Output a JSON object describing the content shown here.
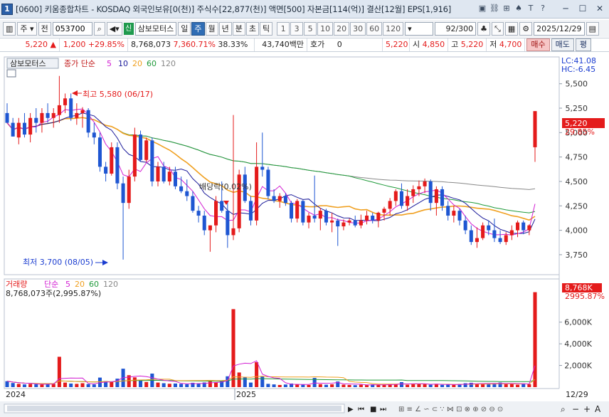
{
  "window": {
    "number": "1",
    "title": "[0600] 키움종합차트 - KOSDAQ 외국인보유[0(천)] 주식수[22,877(천)] 액면[500] 자본금[114(억)] 결산[12월] EPS[1,916]"
  },
  "toolbar": {
    "market_select": "주",
    "all_button": "전",
    "stock_code": "053700",
    "credit_badge": "신",
    "stock_name": "삼보모터스",
    "period_buttons": [
      "일",
      "주",
      "월",
      "년",
      "분",
      "초",
      "틱"
    ],
    "active_period": "주",
    "minute_buttons": [
      "1",
      "3",
      "5",
      "10",
      "20",
      "30",
      "60",
      "120"
    ],
    "count": "92/300",
    "date": "2025/12/29"
  },
  "quote": {
    "price": "5,220",
    "change": "1,200",
    "change_pct": "+29.85%",
    "volume": "8,768,073",
    "volume_pct": "7,360.71%",
    "turnover_pct": "38.33%",
    "amount": "43,740백만",
    "hoga_label": "호가",
    "hoga_value": "0",
    "hoga_price": "5,220",
    "open_label": "시",
    "open_value": "4,850",
    "high_label": "고",
    "high_value": "5,220",
    "low_label": "저",
    "low_value": "4,700",
    "buy_button": "매수",
    "sell_button": "매도",
    "eval_button": "평"
  },
  "price_panel": {
    "stock_tab": "삼보모터스",
    "legend_label": "종가 단순",
    "legend_periods": [
      "5",
      "10",
      "20",
      "60",
      "120"
    ],
    "lc": "LC:41.08",
    "hc": "HC:-6.45",
    "high_annotation": "최고 5,580 (06/17)",
    "low_annotation": "최저 3,700 (08/05)",
    "dividend_annotation": "배당락(0.02%)",
    "current_price_label": "5,220",
    "current_change_label": "29.85%"
  },
  "volume_panel": {
    "legend_label": "거래량",
    "legend_ma": "단순",
    "legend_periods": [
      "5",
      "20",
      "60",
      "120"
    ],
    "volume_text": "8,768,073주(2,995.87%)",
    "current_volume_label": "8,768K",
    "current_volume_pct": "2995.87%"
  },
  "x_axis": {
    "labels": [
      "2024",
      "2025"
    ],
    "right_label": "12/29"
  },
  "colors": {
    "up": "#e41b1b",
    "down": "#1e56d2",
    "ma5": "#d21ed2",
    "ma10": "#1a1a9a",
    "ma20": "#f0a020",
    "ma60": "#1f9a3a",
    "ma120": "#888888"
  },
  "chart_data": {
    "type": "candlestick",
    "price_axis": {
      "ticks": [
        3750,
        4000,
        4250,
        4500,
        4750,
        5000,
        5250,
        5500
      ],
      "ylim": [
        3560,
        5760
      ]
    },
    "volume_axis": {
      "ticks_k": [
        2000,
        4000,
        6000
      ],
      "ylim_k": [
        0,
        9200
      ]
    },
    "candles": [
      [
        5200,
        5300,
        5100,
        5100
      ],
      [
        5100,
        5150,
        4960,
        4960
      ],
      [
        4950,
        5150,
        4880,
        5100
      ],
      [
        5100,
        5200,
        4950,
        4980
      ],
      [
        4980,
        5200,
        4900,
        5150
      ],
      [
        5150,
        5250,
        5000,
        5100
      ],
      [
        5100,
        5250,
        5000,
        5200
      ],
      [
        5200,
        5300,
        5100,
        5150
      ],
      [
        5150,
        5250,
        5050,
        5200
      ],
      [
        5180,
        5580,
        5100,
        5280
      ],
      [
        5280,
        5400,
        5200,
        5350
      ],
      [
        5350,
        5400,
        5120,
        5150
      ],
      [
        5150,
        5300,
        5080,
        5200
      ],
      [
        5200,
        5260,
        5050,
        5230
      ],
      [
        5230,
        5250,
        4950,
        5000
      ],
      [
        5000,
        5100,
        4880,
        4950
      ],
      [
        4950,
        5000,
        4600,
        4650
      ],
      [
        4650,
        4700,
        4500,
        4580
      ],
      [
        4580,
        4900,
        4560,
        4850
      ],
      [
        4850,
        4900,
        4420,
        4480
      ],
      [
        4480,
        4550,
        3700,
        4280
      ],
      [
        4280,
        4620,
        4220,
        4550
      ],
      [
        4550,
        5050,
        4500,
        4980
      ],
      [
        4980,
        5020,
        4700,
        4720
      ],
      [
        4720,
        4950,
        4700,
        4920
      ],
      [
        4920,
        4950,
        4450,
        4500
      ],
      [
        4500,
        4700,
        4450,
        4650
      ],
      [
        4650,
        4700,
        4480,
        4500
      ],
      [
        4500,
        4650,
        4460,
        4600
      ],
      [
        4600,
        4650,
        4420,
        4450
      ],
      [
        4450,
        4550,
        4380,
        4400
      ],
      [
        4400,
        4520,
        4300,
        4350
      ],
      [
        4350,
        4400,
        4180,
        4200
      ],
      [
        4200,
        4250,
        4080,
        4150
      ],
      [
        4150,
        4200,
        3950,
        4000
      ],
      [
        4000,
        4050,
        3780,
        4050
      ],
      [
        4050,
        4350,
        3980,
        4300
      ],
      [
        4300,
        4500,
        4180,
        4200
      ],
      [
        4200,
        4300,
        3820,
        3950
      ],
      [
        3950,
        5180,
        3900,
        4020
      ],
      [
        4020,
        4620,
        3980,
        4570
      ],
      [
        4570,
        4650,
        4280,
        4300
      ],
      [
        4300,
        4350,
        4050,
        4100
      ],
      [
        4100,
        4900,
        4050,
        4650
      ],
      [
        4650,
        5000,
        4550,
        4620
      ],
      [
        4620,
        4650,
        4320,
        4350
      ],
      [
        4350,
        4420,
        4280,
        4300
      ],
      [
        4300,
        4380,
        4230,
        4350
      ],
      [
        4350,
        4380,
        4250,
        4280
      ],
      [
        4280,
        4300,
        4080,
        4120
      ],
      [
        4120,
        4320,
        4080,
        4300
      ],
      [
        4300,
        4310,
        4050,
        4080
      ],
      [
        4080,
        4180,
        4020,
        4150
      ],
      [
        4150,
        4560,
        4080,
        4120
      ],
      [
        4120,
        4230,
        4000,
        4200
      ],
      [
        4200,
        4220,
        4050,
        4080
      ],
      [
        4080,
        4180,
        3980,
        4100
      ],
      [
        4100,
        4120,
        3840,
        4040
      ],
      [
        4040,
        4110,
        4000,
        4080
      ],
      [
        4080,
        4120,
        4050,
        4100
      ],
      [
        4100,
        4150,
        4030,
        4050
      ],
      [
        4050,
        4160,
        4020,
        4100
      ],
      [
        4100,
        4200,
        4060,
        4150
      ],
      [
        4150,
        4180,
        4070,
        4100
      ],
      [
        4100,
        4190,
        4030,
        4180
      ],
      [
        4180,
        4240,
        4100,
        4220
      ],
      [
        4220,
        4330,
        4150,
        4300
      ],
      [
        4300,
        4420,
        4250,
        4400
      ],
      [
        4400,
        4480,
        4220,
        4250
      ],
      [
        4250,
        4420,
        4200,
        4350
      ],
      [
        4350,
        4460,
        4280,
        4420
      ],
      [
        4420,
        4510,
        4350,
        4450
      ],
      [
        4450,
        4530,
        4380,
        4500
      ],
      [
        4500,
        4520,
        4200,
        4280
      ],
      [
        4280,
        4450,
        4150,
        4420
      ],
      [
        4420,
        4450,
        4200,
        4250
      ],
      [
        4250,
        4300,
        4100,
        4150
      ],
      [
        4150,
        4250,
        4080,
        4200
      ],
      [
        4200,
        4220,
        4050,
        4100
      ],
      [
        4100,
        4150,
        3960,
        4000
      ],
      [
        4000,
        4050,
        3850,
        3880
      ],
      [
        3880,
        4030,
        3820,
        3920
      ],
      [
        3920,
        4080,
        3900,
        4050
      ],
      [
        4050,
        4100,
        3950,
        4000
      ],
      [
        4000,
        4120,
        3880,
        3920
      ],
      [
        3920,
        4000,
        3860,
        3880
      ],
      [
        3880,
        3980,
        3850,
        3950
      ],
      [
        3950,
        4050,
        3900,
        4000
      ],
      [
        4000,
        4100,
        3930,
        4080
      ],
      [
        4080,
        4100,
        3960,
        4000
      ],
      [
        4000,
        4060,
        3950,
        4050
      ],
      [
        4850,
        5220,
        4700,
        5220
      ]
    ],
    "volumes_k": [
      550,
      380,
      300,
      250,
      290,
      260,
      230,
      330,
      300,
      2800,
      420,
      330,
      300,
      360,
      280,
      250,
      880,
      560,
      470,
      780,
      1700,
      1100,
      900,
      650,
      470,
      1250,
      420,
      360,
      310,
      330,
      300,
      270,
      400,
      350,
      430,
      520,
      440,
      600,
      1000,
      7200,
      1350,
      900,
      420,
      2300,
      1000,
      300,
      250,
      200,
      240,
      330,
      270,
      220,
      200,
      850,
      270,
      220,
      260,
      520,
      230,
      200,
      180,
      220,
      190,
      250,
      230,
      210,
      280,
      290,
      460,
      220,
      310,
      280,
      260,
      220,
      300,
      210,
      250,
      210,
      280,
      360,
      400,
      300,
      290,
      310,
      370,
      420,
      280,
      310,
      220,
      340,
      270,
      8768
    ]
  }
}
